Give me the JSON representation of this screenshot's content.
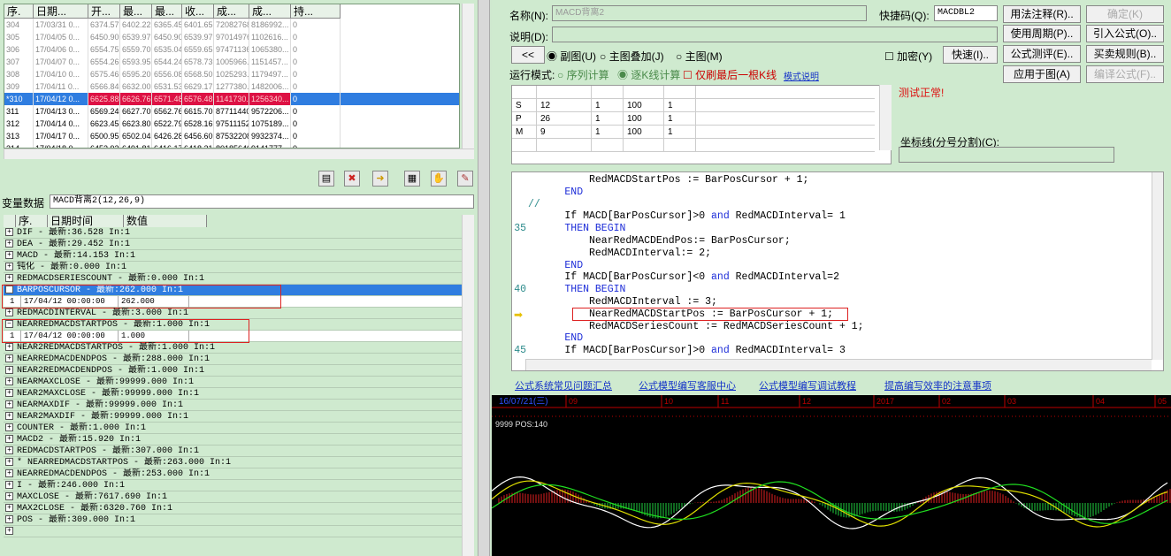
{
  "top_table": {
    "headers": [
      "序.",
      "日期...",
      "开...",
      "最...",
      "最...",
      "收...",
      "成...",
      "成...",
      "持..."
    ],
    "rows": [
      {
        "cells": [
          "304",
          "17/03/31 0...",
          "6374.57",
          "6402.22",
          "6365.45",
          "6401.65",
          "72082768",
          "8186992...",
          "0"
        ],
        "state": "normal"
      },
      {
        "cells": [
          "305",
          "17/04/05 0...",
          "6450.90",
          "6539.97",
          "6450.90",
          "6539.97",
          "97014976",
          "1102616...",
          "0"
        ],
        "state": "normal"
      },
      {
        "cells": [
          "306",
          "17/04/06 0...",
          "6554.75",
          "6559.70",
          "6535.04",
          "6559.65",
          "97471136",
          "1065380...",
          "0"
        ],
        "state": "normal"
      },
      {
        "cells": [
          "307",
          "17/04/07 0...",
          "6554.26",
          "6593.95",
          "6544.24",
          "6578.73",
          "1005966...",
          "1151457...",
          "0"
        ],
        "state": "normal"
      },
      {
        "cells": [
          "308",
          "17/04/10 0...",
          "6575.46",
          "6595.20",
          "6556.08",
          "6568.50",
          "1025293...",
          "1179497...",
          "0"
        ],
        "state": "normal"
      },
      {
        "cells": [
          "309",
          "17/04/11 0...",
          "6566.84",
          "6632.00",
          "6531.53",
          "6629.17",
          "1277380...",
          "1482006...",
          "0"
        ],
        "state": "normal"
      },
      {
        "cells": [
          "*310",
          "17/04/12 0...",
          "6625.88",
          "6626.76",
          "6571.48",
          "6576.48",
          "1141730...",
          "1256340...",
          "0"
        ],
        "state": "selected"
      },
      {
        "cells": [
          "311",
          "17/04/13 0...",
          "6569.24",
          "6627.70",
          "6562.76",
          "6615.70",
          "87711440",
          "9572206...",
          "0"
        ],
        "state": "dark"
      },
      {
        "cells": [
          "312",
          "17/04/14 0...",
          "6623.45",
          "6623.80",
          "6522.79",
          "6528.16",
          "97511152",
          "1075189...",
          "0"
        ],
        "state": "dark"
      },
      {
        "cells": [
          "313",
          "17/04/17 0...",
          "6500.95",
          "6502.04",
          "6426.28",
          "6456.60",
          "87532208",
          "9932374...",
          "0"
        ],
        "state": "dark"
      },
      {
        "cells": [
          "314",
          "17/04/18 0...",
          "6452.92",
          "6491.81",
          "6416.17",
          "6418.21",
          "80185640",
          "9141777...",
          "0"
        ],
        "state": "dark"
      }
    ]
  },
  "variables": {
    "label": "变量数据",
    "formula_name": "MACD背离2(12,26,9)",
    "headers": [
      "序.",
      "日期时间",
      "数值"
    ],
    "rows": [
      {
        "text": "DIF  -  最新:36.528  In:1",
        "sel": false
      },
      {
        "text": "DEA  -  最新:29.452  In:1",
        "sel": false
      },
      {
        "text": "MACD  -  最新:14.153  In:1",
        "sel": false
      },
      {
        "text": "钝化  -  最新:0.000  In:1",
        "sel": false
      },
      {
        "text": "REDMACDSERIESCOUNT  -  最新:0.000  In:1",
        "sel": false
      },
      {
        "text": "BARPOSCURSOR  -  最新:262.000  In:1",
        "sel": true,
        "expanded": true,
        "sub": [
          "1",
          "17/04/12 00:00:00",
          "262.000"
        ]
      },
      {
        "text": "REDMACDINTERVAL  -  最新:3.000  In:1",
        "sel": false
      },
      {
        "text": "NEARREDMACDSTARTPOS  -  最新:1.000  In:1",
        "sel": false,
        "expanded": true,
        "sub": [
          "1",
          "17/04/12 00:00:00",
          "1.000"
        ]
      },
      {
        "text": "NEAR2REDMACDSTARTPOS  -  最新:1.000  In:1",
        "sel": false
      },
      {
        "text": "NEARREDMACDENDPOS  -  最新:288.000  In:1",
        "sel": false
      },
      {
        "text": "NEAR2REDMACDENDPOS  -  最新:1.000  In:1",
        "sel": false
      },
      {
        "text": "NEARMAXCLOSE  -  最新:99999.000  In:1",
        "sel": false
      },
      {
        "text": "NEAR2MAXCLOSE  -  最新:99999.000  In:1",
        "sel": false
      },
      {
        "text": "NEARMAXDIF  -  最新:99999.000  In:1",
        "sel": false
      },
      {
        "text": "NEAR2MAXDIF  -  最新:99999.000  In:1",
        "sel": false
      },
      {
        "text": "COUNTER  -  最新:1.000  In:1",
        "sel": false
      },
      {
        "text": "MACD2  -  最新:15.920  In:1",
        "sel": false
      },
      {
        "text": "REDMACDSTARTPOS  -  最新:307.000  In:1",
        "sel": false
      },
      {
        "text": "* NEARREDMACDSTARTPOS  -  最新:263.000  In:1",
        "sel": false
      },
      {
        "text": "NEARREDMACDENDPOS  -  最新:253.000  In:1",
        "sel": false
      },
      {
        "text": "I  -  最新:246.000  In:1",
        "sel": false
      },
      {
        "text": "MAXCLOSE  -  最新:7617.690  In:1",
        "sel": false
      },
      {
        "text": "MAX2CLOSE  -  最新:6320.760  In:1",
        "sel": false
      },
      {
        "text": "POS  -  最新:309.000  In:1",
        "sel": false
      },
      {
        "text": "",
        "sel": false
      }
    ]
  },
  "editor": {
    "name_label": "名称(N):",
    "name_value": "MACD背离2",
    "shortcut_label": "快捷码(Q):",
    "shortcut_value": "MACDBL2",
    "desc_label": "说明(D):",
    "desc_value": "",
    "nav_btn": "<<",
    "radio_sub": "副图(U)",
    "radio_overlay": "主图叠加(J)",
    "radio_main": "主图(M)",
    "encrypt_label": "加密(Y)",
    "shortcut_btn": "快速(I)..",
    "run_mode_label": "运行模式:",
    "mode_seq": "序列计算",
    "mode_line": "逐K线计算",
    "only_last": "仅刷最后一根K线",
    "mode_help": "模式说明",
    "test_ok": "测试正常!",
    "coord_label": "坐标线(分号分割)(C):",
    "coord_value": "",
    "buttons": {
      "usage": "用法注释(R)..",
      "confirm": "确定(K)",
      "period": "使用周期(P)..",
      "import": "引入公式(O)..",
      "test": "公式测评(E)..",
      "trade_rules": "买卖规则(B)..",
      "apply": "应用于图(A)",
      "compile": "编译公式(F).."
    },
    "params": [
      [
        "S",
        "12",
        "1",
        "100",
        "1"
      ],
      [
        "P",
        "26",
        "1",
        "100",
        "1"
      ],
      [
        "M",
        "9",
        "1",
        "100",
        "1"
      ]
    ]
  },
  "code": {
    "lines": [
      {
        "num": "",
        "indent": 10,
        "parts": [
          [
            "t",
            "RedMACDStartPos := BarPosCursor + 1;"
          ]
        ]
      },
      {
        "num": "",
        "indent": 6,
        "parts": [
          [
            "k",
            "END"
          ]
        ]
      },
      {
        "num": "",
        "indent": 0,
        "parts": [
          [
            "c",
            "//"
          ]
        ]
      },
      {
        "num": "",
        "indent": 6,
        "parts": [
          [
            "t",
            "If MACD[BarPosCursor]>0 "
          ],
          [
            "k",
            "and"
          ],
          [
            "t",
            " RedMACDInterval= 1"
          ]
        ]
      },
      {
        "num": "35",
        "indent": 6,
        "parts": [
          [
            "k",
            "THEN BEGIN"
          ]
        ]
      },
      {
        "num": "",
        "indent": 10,
        "parts": [
          [
            "t",
            "NearRedMACDEndPos:= BarPosCursor;"
          ]
        ]
      },
      {
        "num": "",
        "indent": 10,
        "parts": [
          [
            "t",
            "RedMACDInterval:= 2;"
          ]
        ]
      },
      {
        "num": "",
        "indent": 6,
        "parts": [
          [
            "k",
            "END"
          ]
        ]
      },
      {
        "num": "",
        "indent": 6,
        "parts": [
          [
            "t",
            "If MACD[BarPosCursor]<0 "
          ],
          [
            "k",
            "and"
          ],
          [
            "t",
            " RedMACDInterval=2"
          ]
        ]
      },
      {
        "num": "40",
        "indent": 6,
        "parts": [
          [
            "k",
            "THEN BEGIN"
          ]
        ]
      },
      {
        "num": "",
        "indent": 10,
        "parts": [
          [
            "t",
            "RedMACDInterval := 3;"
          ]
        ]
      },
      {
        "num": "",
        "indent": 10,
        "parts": [
          [
            "t",
            "NearRedMACDStartPos := BarPosCursor + 1;"
          ]
        ]
      },
      {
        "num": "",
        "indent": 10,
        "parts": [
          [
            "t",
            "RedMACDSeriesCount := RedMACDSeriesCount + 1;"
          ]
        ]
      },
      {
        "num": "",
        "indent": 6,
        "parts": [
          [
            "k",
            "END"
          ]
        ]
      },
      {
        "num": "45",
        "indent": 6,
        "parts": [
          [
            "t",
            "If MACD[BarPosCursor]>0 "
          ],
          [
            "k",
            "and"
          ],
          [
            "t",
            " RedMACDInterval= 3"
          ]
        ]
      }
    ]
  },
  "links": [
    "公式系统常见问题汇总",
    "公式模型编写客服中心",
    "公式模型编写调试教程",
    "提高编写效率的注意事项"
  ],
  "chart": {
    "header_date": "16/07/21(三)",
    "header_ticks": [
      "09",
      "10",
      "11",
      "12",
      "2017",
      "02",
      "03",
      "04",
      "05"
    ],
    "indicator_label": "9999  POS:140"
  }
}
